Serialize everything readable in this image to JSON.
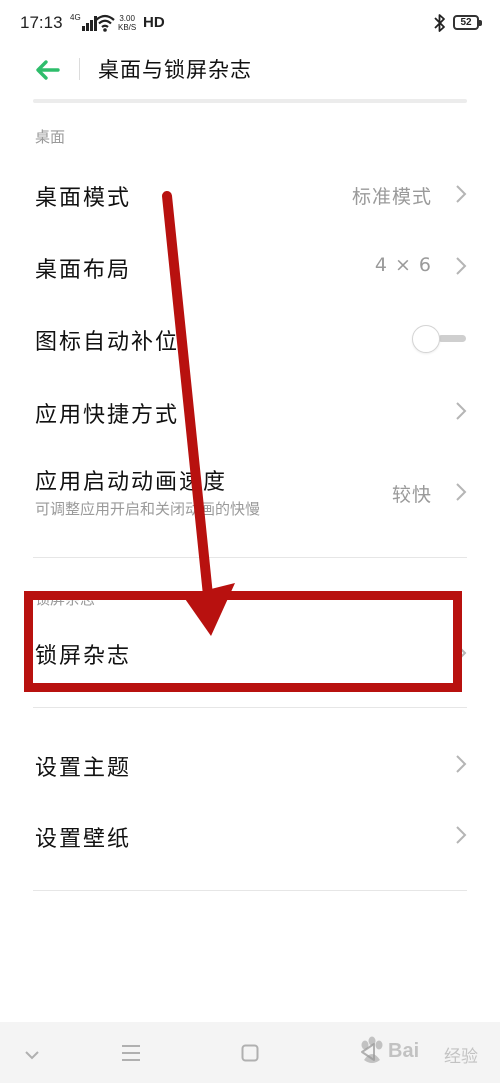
{
  "status_bar": {
    "time": "17:13",
    "network": "4G",
    "speed_value": "3.00",
    "speed_unit": "KB/S",
    "hd": "HD",
    "battery": "52"
  },
  "header": {
    "title": "桌面与锁屏杂志",
    "accent_color": "#2ebd6b"
  },
  "sections": {
    "desktop_label": "桌面",
    "lock_label": "锁屏杂志"
  },
  "rows": {
    "desktop_mode": {
      "title": "桌面模式",
      "value": "标准模式"
    },
    "desktop_layout": {
      "title": "桌面布局",
      "value": "4 × 6"
    },
    "auto_fill": {
      "title": "图标自动补位",
      "enabled": false
    },
    "shortcuts": {
      "title": "应用快捷方式"
    },
    "anim_speed": {
      "title": "应用启动动画速度",
      "subtitle": "可调整应用开启和关闭动画的快慢",
      "value": "较快"
    },
    "lock_magazine": {
      "title": "锁屏杂志"
    },
    "theme": {
      "title": "设置主题"
    },
    "wallpaper": {
      "title": "设置壁纸"
    }
  },
  "annotation": {
    "color": "#b8110f"
  },
  "watermark": {
    "text": "Bai",
    "cn": "经验"
  }
}
